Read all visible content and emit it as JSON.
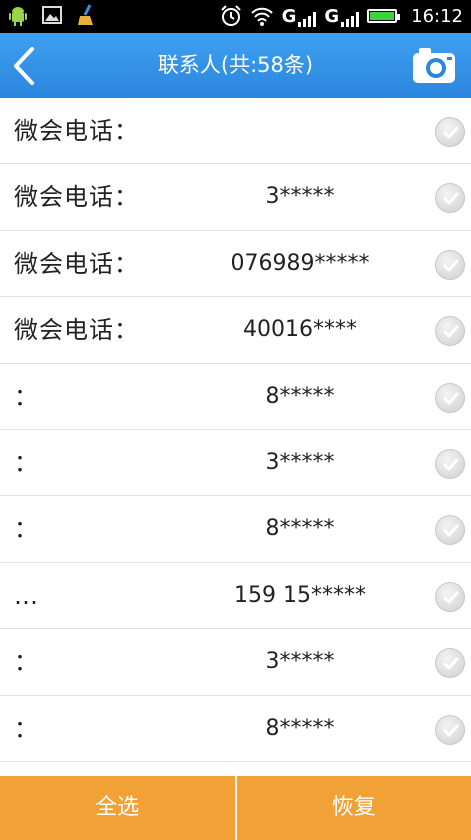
{
  "status_bar": {
    "time": "16:12",
    "signal1": "G",
    "signal2": "G"
  },
  "header": {
    "title": "联系人(共:58条)"
  },
  "contacts": [
    {
      "name": "微会电话：",
      "phone": ""
    },
    {
      "name": "微会电话：",
      "phone": "3*****"
    },
    {
      "name": "微会电话：",
      "phone": "076989*****"
    },
    {
      "name": "微会电话：",
      "phone": "40016****"
    },
    {
      "name": "：",
      "phone": "8*****"
    },
    {
      "name": "：",
      "phone": "3*****"
    },
    {
      "name": "：",
      "phone": "8*****"
    },
    {
      "name": "…",
      "phone": "159 15*****"
    },
    {
      "name": "：",
      "phone": "3*****"
    },
    {
      "name": "：",
      "phone": "8*****"
    }
  ],
  "bottom": {
    "select_all": "全选",
    "restore": "恢复"
  },
  "colors": {
    "header": "#2b86dd",
    "bottom_bar": "#f2a136"
  }
}
